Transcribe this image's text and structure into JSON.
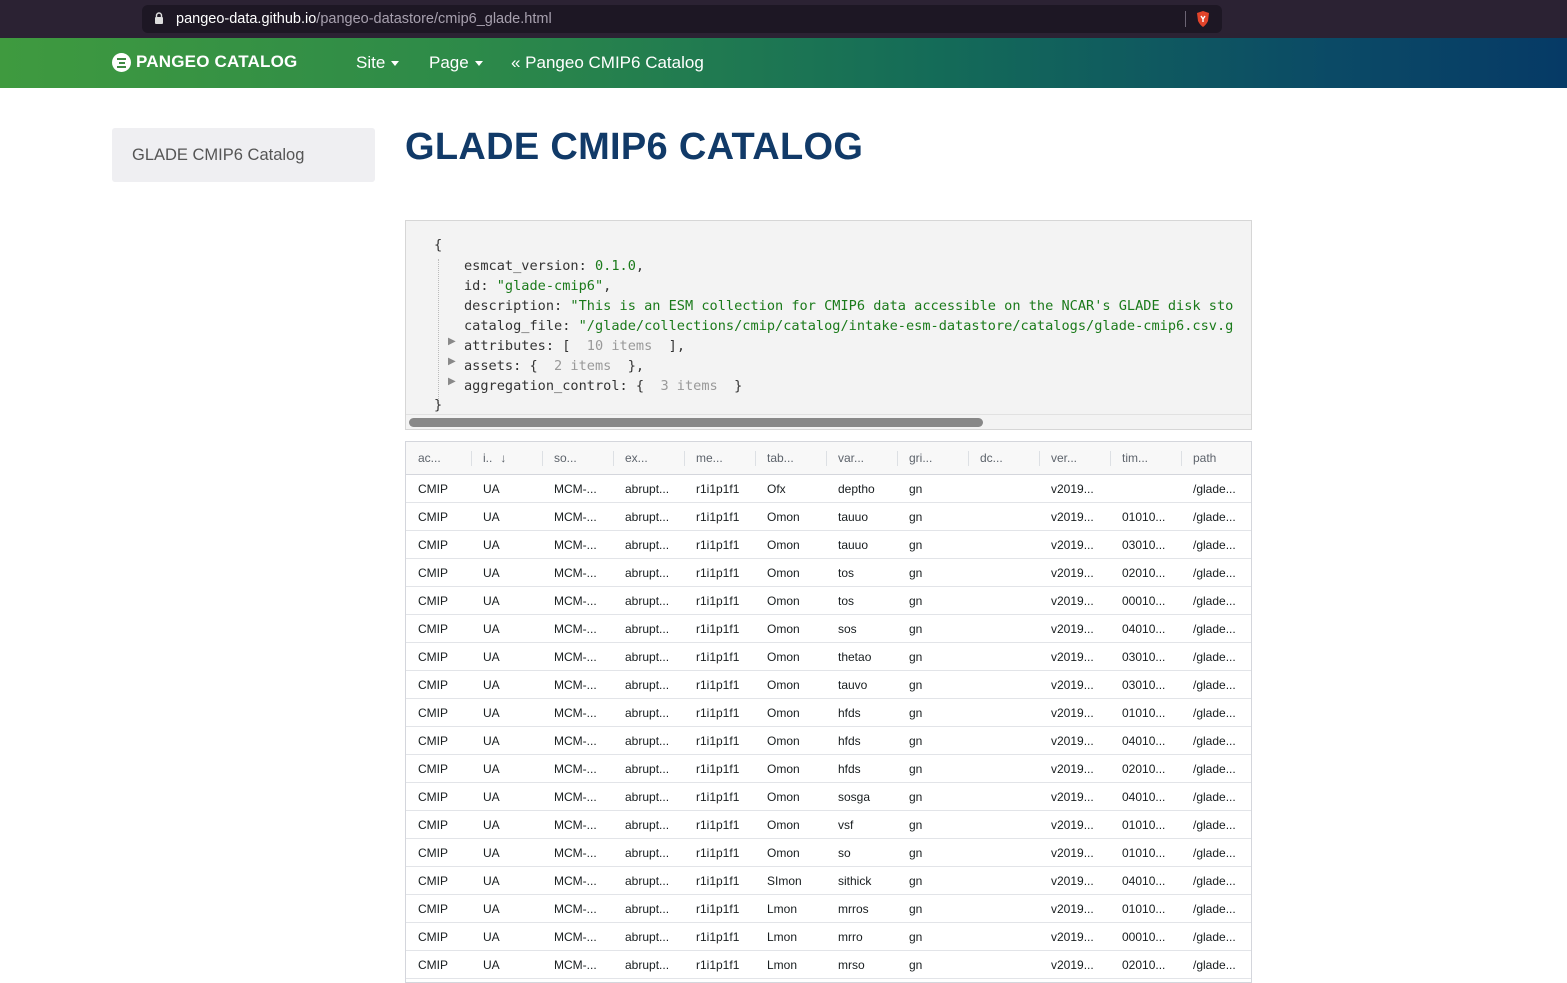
{
  "browser": {
    "url_host": "pangeo-data.github.io",
    "url_path": "/pangeo-datastore/cmip6_glade.html"
  },
  "navbar": {
    "brand": "PANGEO CATALOG",
    "site_label": "Site",
    "page_label": "Page",
    "back_link": "« Pangeo CMIP6 Catalog"
  },
  "sidebar": {
    "link": "GLADE CMIP6 Catalog"
  },
  "title": "GLADE CMIP6 CATALOG",
  "json_view": {
    "open_brace": "{",
    "close_brace": "}",
    "esmcat_version_key": "esmcat_version:",
    "esmcat_version_val": "0.1.0",
    "id_key": "id:",
    "id_val": "\"glade-cmip6\"",
    "description_key": "description:",
    "description_val": "\"This is an ESM collection for CMIP6 data accessible on the NCAR's GLADE disk sto",
    "catalog_file_key": "catalog_file:",
    "catalog_file_val": "\"/glade/collections/cmip/catalog/intake-esm-datastore/catalogs/glade-cmip6.csv.g",
    "attributes_key": "attributes: [",
    "attributes_count": "10 items",
    "attributes_end": "],",
    "assets_key": "assets: {",
    "assets_count": "2 items",
    "assets_end": "},",
    "aggregation_key": "aggregation_control: {",
    "aggregation_count": "3 items",
    "aggregation_end": "}"
  },
  "table": {
    "headers": [
      "ac...",
      "i..",
      "so...",
      "ex...",
      "me...",
      "tab...",
      "var...",
      "gri...",
      "dc...",
      "ver...",
      "tim...",
      "path"
    ],
    "sort_icon": "↓",
    "rows": [
      [
        "CMIP",
        "UA",
        "MCM-...",
        "abrupt...",
        "r1i1p1f1",
        "Ofx",
        "deptho",
        "gn",
        "",
        "v2019...",
        "",
        "/glade..."
      ],
      [
        "CMIP",
        "UA",
        "MCM-...",
        "abrupt...",
        "r1i1p1f1",
        "Omon",
        "tauuo",
        "gn",
        "",
        "v2019...",
        "01010...",
        "/glade..."
      ],
      [
        "CMIP",
        "UA",
        "MCM-...",
        "abrupt...",
        "r1i1p1f1",
        "Omon",
        "tauuo",
        "gn",
        "",
        "v2019...",
        "03010...",
        "/glade..."
      ],
      [
        "CMIP",
        "UA",
        "MCM-...",
        "abrupt...",
        "r1i1p1f1",
        "Omon",
        "tos",
        "gn",
        "",
        "v2019...",
        "02010...",
        "/glade..."
      ],
      [
        "CMIP",
        "UA",
        "MCM-...",
        "abrupt...",
        "r1i1p1f1",
        "Omon",
        "tos",
        "gn",
        "",
        "v2019...",
        "00010...",
        "/glade..."
      ],
      [
        "CMIP",
        "UA",
        "MCM-...",
        "abrupt...",
        "r1i1p1f1",
        "Omon",
        "sos",
        "gn",
        "",
        "v2019...",
        "04010...",
        "/glade..."
      ],
      [
        "CMIP",
        "UA",
        "MCM-...",
        "abrupt...",
        "r1i1p1f1",
        "Omon",
        "thetao",
        "gn",
        "",
        "v2019...",
        "03010...",
        "/glade..."
      ],
      [
        "CMIP",
        "UA",
        "MCM-...",
        "abrupt...",
        "r1i1p1f1",
        "Omon",
        "tauvo",
        "gn",
        "",
        "v2019...",
        "03010...",
        "/glade..."
      ],
      [
        "CMIP",
        "UA",
        "MCM-...",
        "abrupt...",
        "r1i1p1f1",
        "Omon",
        "hfds",
        "gn",
        "",
        "v2019...",
        "01010...",
        "/glade..."
      ],
      [
        "CMIP",
        "UA",
        "MCM-...",
        "abrupt...",
        "r1i1p1f1",
        "Omon",
        "hfds",
        "gn",
        "",
        "v2019...",
        "04010...",
        "/glade..."
      ],
      [
        "CMIP",
        "UA",
        "MCM-...",
        "abrupt...",
        "r1i1p1f1",
        "Omon",
        "hfds",
        "gn",
        "",
        "v2019...",
        "02010...",
        "/glade..."
      ],
      [
        "CMIP",
        "UA",
        "MCM-...",
        "abrupt...",
        "r1i1p1f1",
        "Omon",
        "sosga",
        "gn",
        "",
        "v2019...",
        "04010...",
        "/glade..."
      ],
      [
        "CMIP",
        "UA",
        "MCM-...",
        "abrupt...",
        "r1i1p1f1",
        "Omon",
        "vsf",
        "gn",
        "",
        "v2019...",
        "01010...",
        "/glade..."
      ],
      [
        "CMIP",
        "UA",
        "MCM-...",
        "abrupt...",
        "r1i1p1f1",
        "Omon",
        "so",
        "gn",
        "",
        "v2019...",
        "01010...",
        "/glade..."
      ],
      [
        "CMIP",
        "UA",
        "MCM-...",
        "abrupt...",
        "r1i1p1f1",
        "SImon",
        "sithick",
        "gn",
        "",
        "v2019...",
        "04010...",
        "/glade..."
      ],
      [
        "CMIP",
        "UA",
        "MCM-...",
        "abrupt...",
        "r1i1p1f1",
        "Lmon",
        "mrros",
        "gn",
        "",
        "v2019...",
        "01010...",
        "/glade..."
      ],
      [
        "CMIP",
        "UA",
        "MCM-...",
        "abrupt...",
        "r1i1p1f1",
        "Lmon",
        "mrro",
        "gn",
        "",
        "v2019...",
        "00010...",
        "/glade..."
      ],
      [
        "CMIP",
        "UA",
        "MCM-...",
        "abrupt...",
        "r1i1p1f1",
        "Lmon",
        "mrso",
        "gn",
        "",
        "v2019...",
        "02010...",
        "/glade..."
      ]
    ]
  }
}
